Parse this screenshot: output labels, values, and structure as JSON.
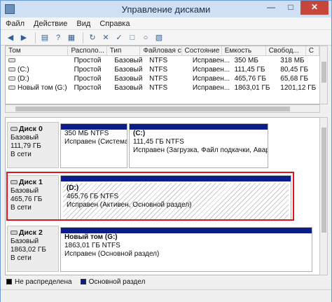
{
  "window": {
    "title": "Управление дисками"
  },
  "menu": [
    "Файл",
    "Действие",
    "Вид",
    "Справка"
  ],
  "volume_table": {
    "columns": [
      "Том",
      "Располо...",
      "Тип",
      "Файловая с...",
      "Состояние",
      "Емкость",
      "Свобод...",
      "С"
    ],
    "rows": [
      {
        "name": "",
        "layout": "Простой",
        "type": "Базовый",
        "fs": "NTFS",
        "status": "Исправен...",
        "capacity": "350 МБ",
        "free": "318 МБ"
      },
      {
        "name": "(C:)",
        "layout": "Простой",
        "type": "Базовый",
        "fs": "NTFS",
        "status": "Исправен...",
        "capacity": "111,45 ГБ",
        "free": "80,45 ГБ"
      },
      {
        "name": "(D:)",
        "layout": "Простой",
        "type": "Базовый",
        "fs": "NTFS",
        "status": "Исправен...",
        "capacity": "465,76 ГБ",
        "free": "65,68 ГБ"
      },
      {
        "name": "Новый том (G:)",
        "layout": "Простой",
        "type": "Базовый",
        "fs": "NTFS",
        "status": "Исправен...",
        "capacity": "1863,01 ГБ",
        "free": "1201,12 ГБ"
      }
    ]
  },
  "disks": [
    {
      "name": "Диск 0",
      "type": "Базовый",
      "size": "111,79 ГБ",
      "state": "В сети",
      "partitions": [
        {
          "title": "",
          "size": "350 МБ NTFS",
          "status": "Исправен (Система, А"
        },
        {
          "title": "(C:)",
          "size": "111,45 ГБ NTFS",
          "status": "Исправен (Загрузка, Файл подкачки, Аварий"
        }
      ]
    },
    {
      "name": "Диск 1",
      "type": "Базовый",
      "size": "465,76 ГБ",
      "state": "В сети",
      "partitions": [
        {
          "title": "(D:)",
          "size": "465,76 ГБ NTFS",
          "status": "Исправен (Активен, Основной раздел)"
        }
      ]
    },
    {
      "name": "Диск 2",
      "type": "Базовый",
      "size": "1863,02 ГБ",
      "state": "В сети",
      "partitions": [
        {
          "title": "Новый том (G:)",
          "size": "1863,01 ГБ NTFS",
          "status": "Исправен (Основной раздел)"
        }
      ]
    }
  ],
  "legend": [
    {
      "label": "Не распределена",
      "color": "#000000"
    },
    {
      "label": "Основной раздел",
      "color": "#0b1d8a"
    }
  ]
}
